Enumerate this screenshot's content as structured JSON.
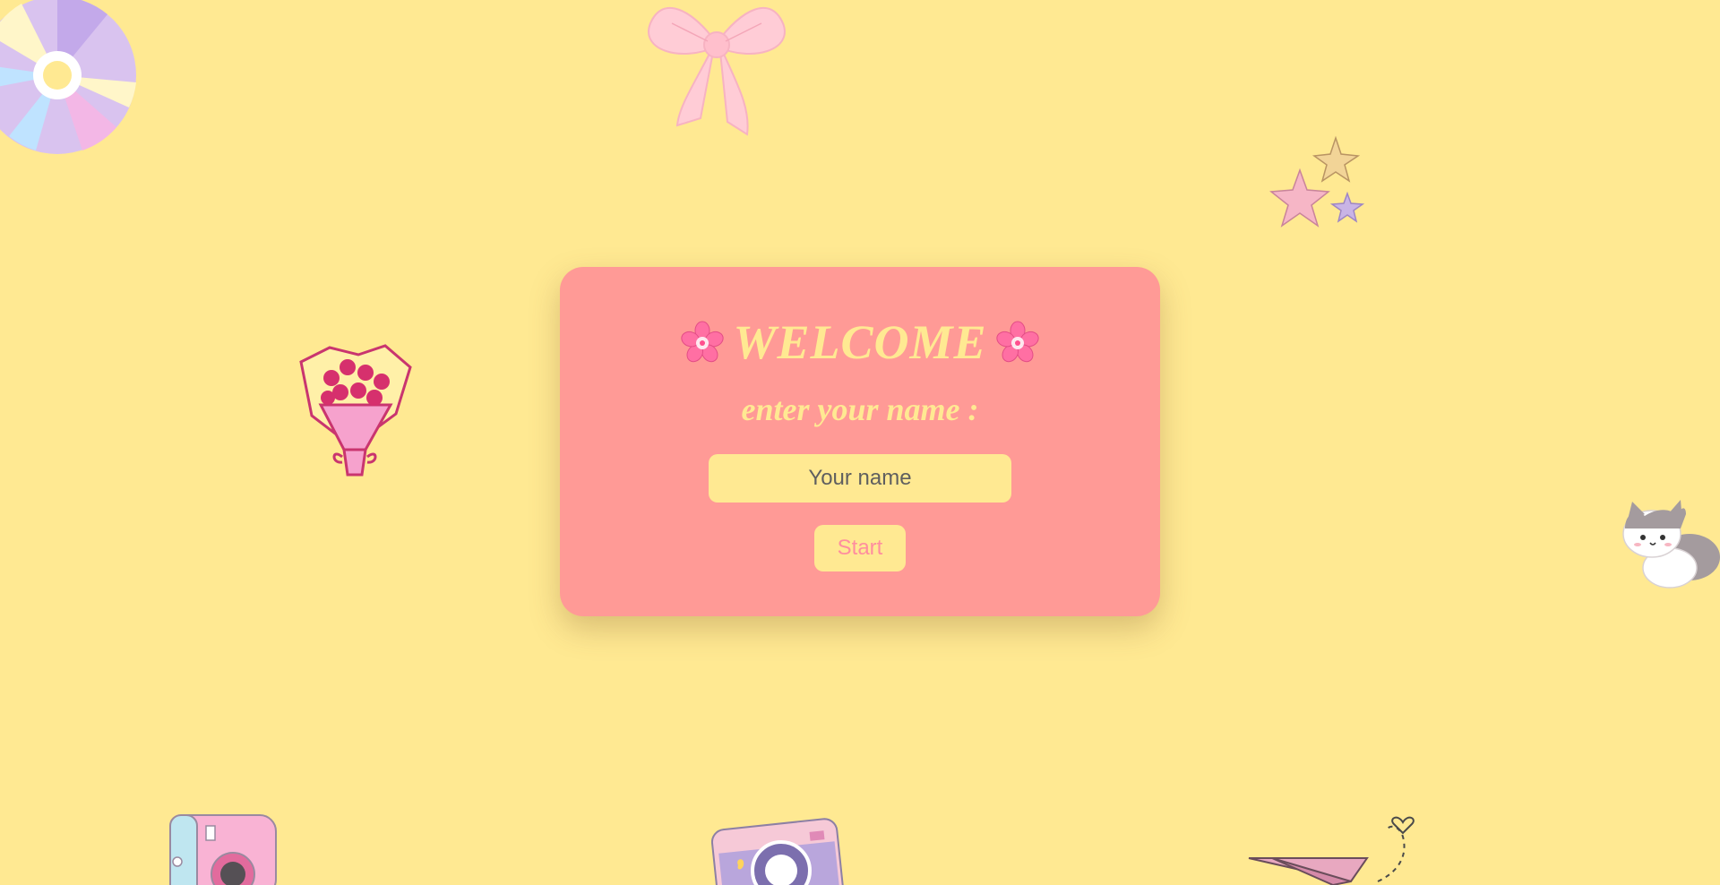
{
  "welcome": {
    "title": "WELCOME",
    "subtitle": "enter your name :",
    "input": {
      "value": "",
      "placeholder": "Your name"
    },
    "start_label": "Start"
  },
  "colors": {
    "background": "#ffe992",
    "card": "#ff9a96",
    "accent": "#ffe992",
    "button_text": "#ff8e9f"
  },
  "decorations": [
    "cd-disc-icon",
    "pink-bow-icon",
    "stars-icon",
    "flower-bouquet-icon",
    "cat-icon",
    "instant-camera-icon",
    "retro-camera-icon",
    "paper-plane-icon"
  ]
}
